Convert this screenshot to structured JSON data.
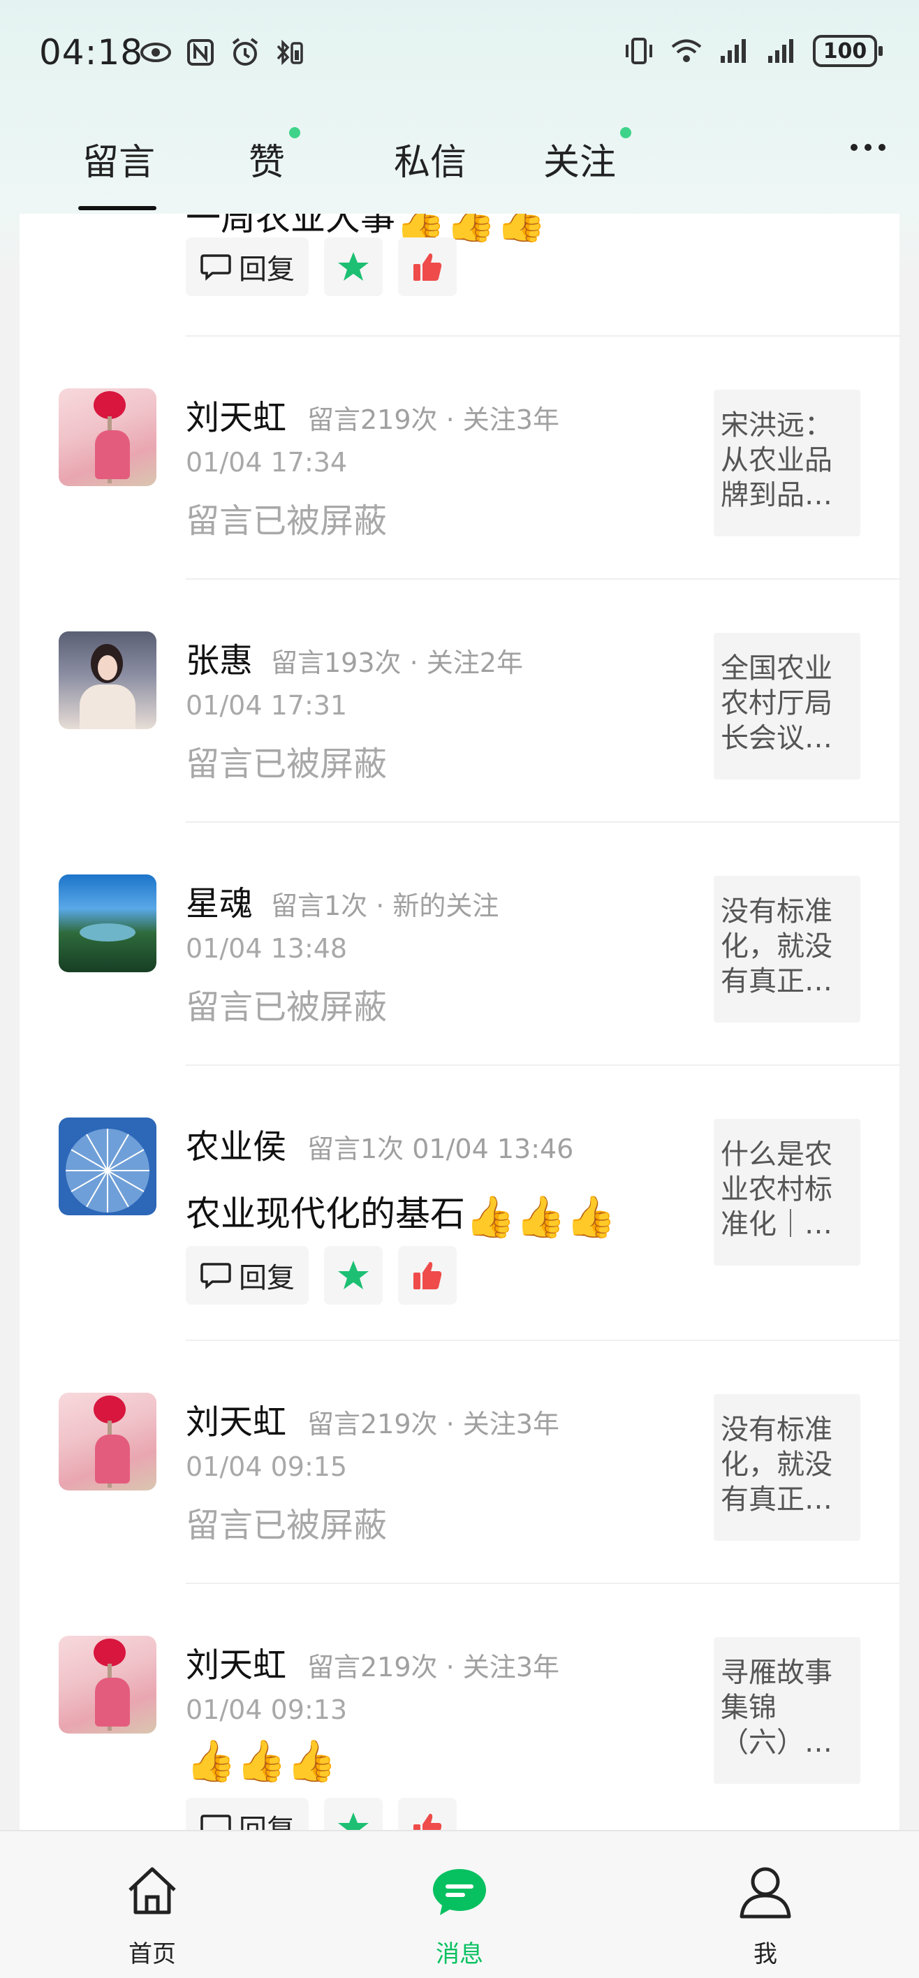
{
  "status_bar": {
    "time": "04:18",
    "battery": "100",
    "icons": [
      "eye-icon",
      "nfc-icon",
      "alarm-icon",
      "bluetooth-battery-icon",
      "vibrate-icon",
      "wifi-icon",
      "signal-icon",
      "signal-icon"
    ]
  },
  "tabs": [
    {
      "label": "留言",
      "active": true,
      "dot": false
    },
    {
      "label": "赞",
      "active": false,
      "dot": true
    },
    {
      "label": "私信",
      "active": false,
      "dot": false
    },
    {
      "label": "关注",
      "active": false,
      "dot": true
    }
  ],
  "actions": {
    "reply_label": "回复"
  },
  "partial_top_item": {
    "content_fragment": "一周农业大事"
  },
  "items": [
    {
      "name": "刘天虹",
      "meta": "留言219次 · 关注3年",
      "date": "01/04 17:34",
      "text": "留言已被屏蔽",
      "article": "宋洪远：从农业品牌到品…",
      "avatar": "rose"
    },
    {
      "name": "张惠",
      "meta": "留言193次 · 关注2年",
      "date": "01/04 17:31",
      "text": "留言已被屏蔽",
      "article": "全国农业农村厅局长会议…",
      "avatar": "girl"
    },
    {
      "name": "星魂",
      "meta": "留言1次 · 新的关注",
      "date": "01/04 13:48",
      "text": "留言已被屏蔽",
      "article": "没有标准化，就没有真正…",
      "avatar": "lake"
    },
    {
      "name": "农业侯",
      "meta": "留言1次 01/04 13:46",
      "date": "",
      "text": "农业现代化的基石",
      "article": "什么是农业农村标准化｜…",
      "avatar": "wheel"
    },
    {
      "name": "刘天虹",
      "meta": "留言219次 · 关注3年",
      "date": "01/04 09:15",
      "text": "留言已被屏蔽",
      "article": "没有标准化，就没有真正…",
      "avatar": "rose"
    },
    {
      "name": "刘天虹",
      "meta": "留言219次 · 关注3年",
      "date": "01/04 09:13",
      "text": "",
      "article": "寻雁故事集锦（六）…",
      "avatar": "rose"
    }
  ],
  "bottom_nav": [
    {
      "label": "首页",
      "icon": "home-icon",
      "active": false
    },
    {
      "label": "消息",
      "icon": "message-icon",
      "active": true
    },
    {
      "label": "我",
      "icon": "profile-icon",
      "active": false
    }
  ],
  "colors": {
    "accent": "#07c160",
    "tab_dot": "#3fd38a",
    "star": "#1dbf73",
    "like": "#ef4b4b"
  }
}
